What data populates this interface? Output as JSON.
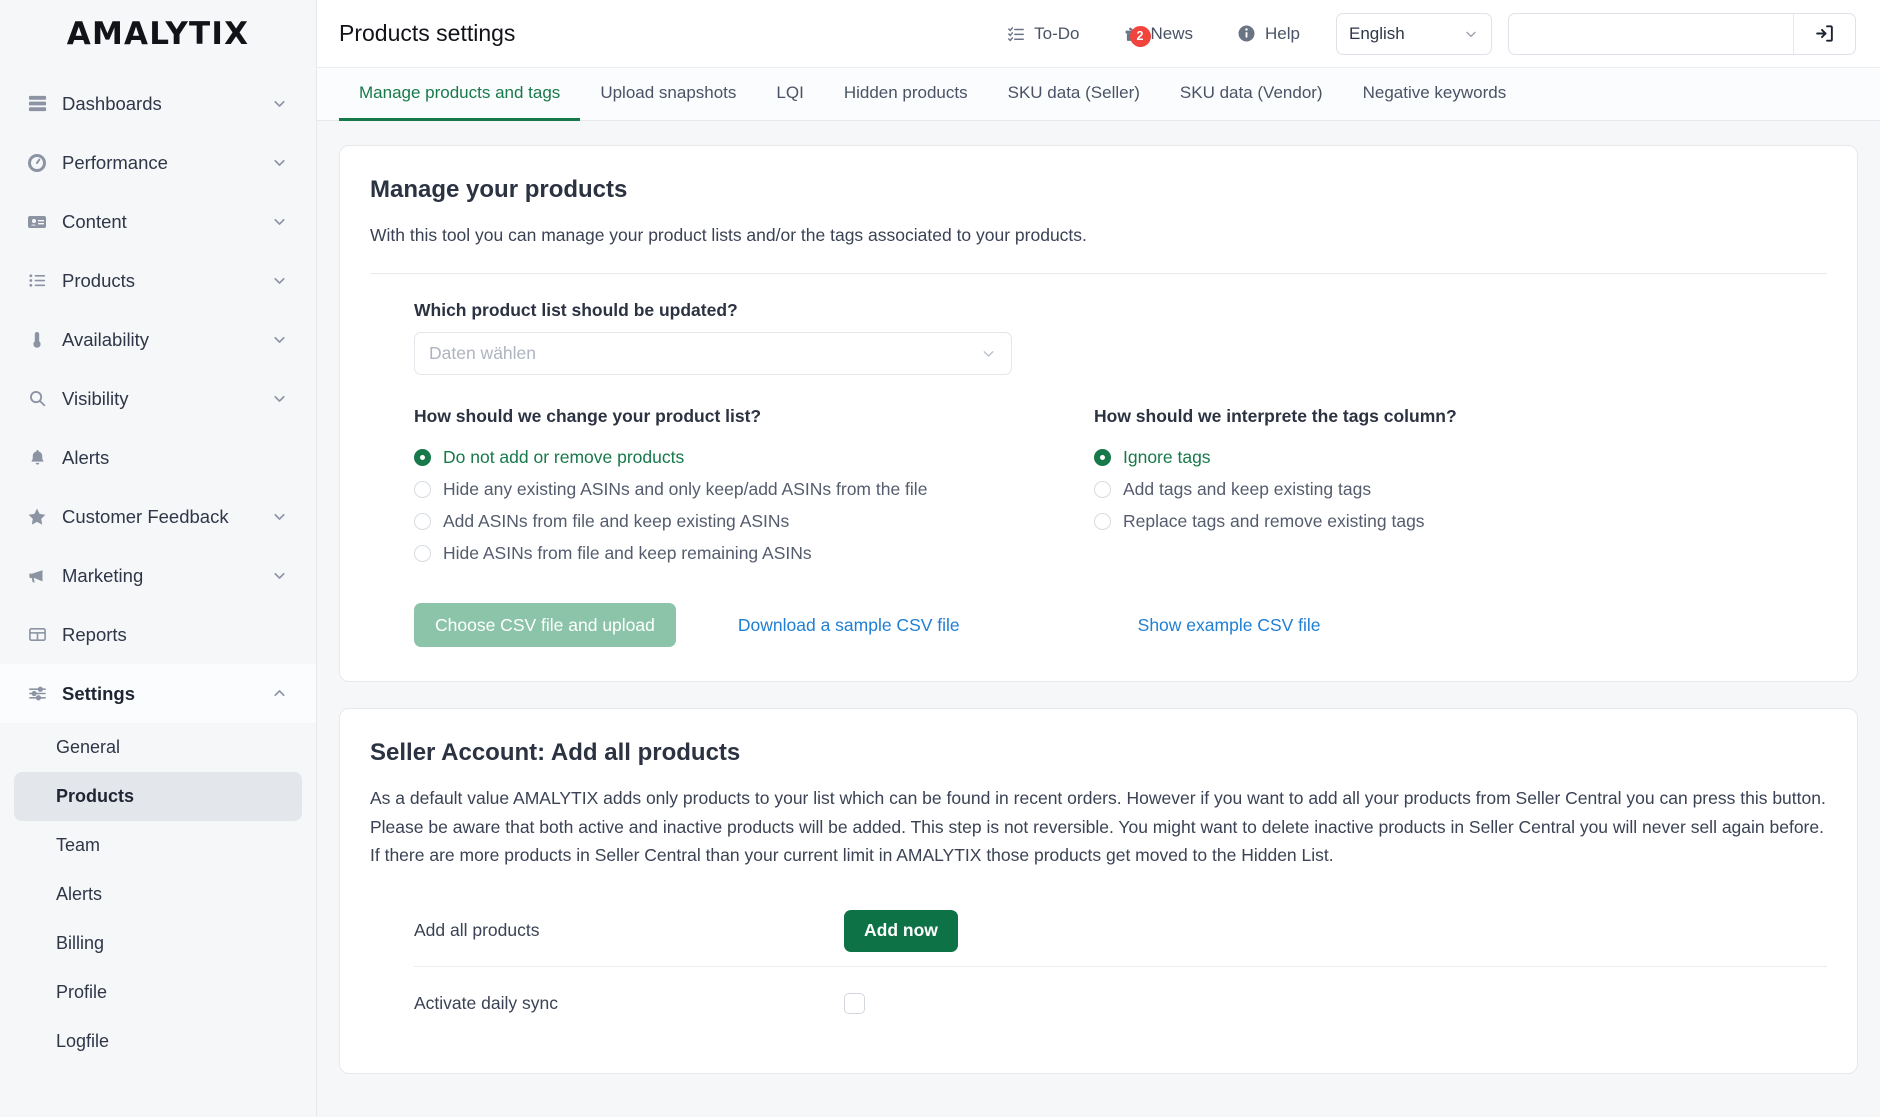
{
  "brand": {
    "name": "AMALYTIX"
  },
  "sidebar": {
    "items": [
      {
        "label": "Dashboards",
        "icon": "dashboards-icon",
        "chevron": "down"
      },
      {
        "label": "Performance",
        "icon": "gauge-icon",
        "chevron": "down"
      },
      {
        "label": "Content",
        "icon": "id-card-icon",
        "chevron": "down"
      },
      {
        "label": "Products",
        "icon": "list-icon",
        "chevron": "down"
      },
      {
        "label": "Availability",
        "icon": "thermometer-icon",
        "chevron": "down"
      },
      {
        "label": "Visibility",
        "icon": "search-icon",
        "chevron": "down"
      },
      {
        "label": "Alerts",
        "icon": "bell-icon",
        "chevron": "none"
      },
      {
        "label": "Customer Feedback",
        "icon": "star-icon",
        "chevron": "down"
      },
      {
        "label": "Marketing",
        "icon": "megaphone-icon",
        "chevron": "down"
      },
      {
        "label": "Reports",
        "icon": "table-icon",
        "chevron": "none"
      },
      {
        "label": "Settings",
        "icon": "sliders-icon",
        "chevron": "up"
      }
    ],
    "settings_submenu": [
      {
        "label": "General",
        "selected": false
      },
      {
        "label": "Products",
        "selected": true
      },
      {
        "label": "Team",
        "selected": false
      },
      {
        "label": "Alerts",
        "selected": false
      },
      {
        "label": "Billing",
        "selected": false
      },
      {
        "label": "Profile",
        "selected": false
      },
      {
        "label": "Logfile",
        "selected": false
      }
    ]
  },
  "topbar": {
    "page_title": "Products settings",
    "todo_label": "To-Do",
    "news_label": "News",
    "news_badge": "2",
    "help_label": "Help",
    "language": "English",
    "search_value": "",
    "search_placeholder": ""
  },
  "tabs": [
    {
      "label": "Manage products and tags",
      "active": true
    },
    {
      "label": "Upload snapshots",
      "active": false
    },
    {
      "label": "LQI",
      "active": false
    },
    {
      "label": "Hidden products",
      "active": false
    },
    {
      "label": "SKU data (Seller)",
      "active": false
    },
    {
      "label": "SKU data (Vendor)",
      "active": false
    },
    {
      "label": "Negative keywords",
      "active": false
    }
  ],
  "manage_card": {
    "title": "Manage your products",
    "description": "With this tool you can manage your product lists and/or the tags associated to your products.",
    "list_field_label": "Which product list should be updated?",
    "list_select_placeholder": "Daten wählen",
    "list_select_value": "",
    "change_group_label": "How should we change your product list?",
    "change_options": [
      {
        "label": "Do not add or remove products",
        "selected": true
      },
      {
        "label": "Hide any existing ASINs and only keep/add ASINs from the file",
        "selected": false
      },
      {
        "label": "Add ASINs from file and keep existing ASINs",
        "selected": false
      },
      {
        "label": "Hide ASINs from file and keep remaining ASINs",
        "selected": false
      }
    ],
    "tags_group_label": "How should we interprete the tags column?",
    "tags_options": [
      {
        "label": "Ignore tags",
        "selected": true
      },
      {
        "label": "Add tags and keep existing tags",
        "selected": false
      },
      {
        "label": "Replace tags and remove existing tags",
        "selected": false
      }
    ],
    "upload_button": "Choose CSV file and upload",
    "sample_link": "Download a sample CSV file",
    "example_link": "Show example CSV file"
  },
  "seller_card": {
    "title": "Seller Account: Add all products",
    "description": "As a default value AMALYTIX adds only products to your list which can be found in recent orders. However if you want to add all your products from Seller Central you can press this button. Please be aware that both active and inactive products will be added. This step is not reversible. You might want to delete inactive products in Seller Central you will never sell again before. If there are more products in Seller Central than your current limit in AMALYTIX those products get moved to the Hidden List.",
    "add_all_label": "Add all products",
    "add_now_button": "Add now",
    "daily_sync_label": "Activate daily sync",
    "daily_sync_checked": false
  },
  "colors": {
    "accent_green": "#17794a",
    "button_green": "#0d7347",
    "muted_green": "#8cc4a9",
    "link_blue": "#1f7fd4",
    "badge_red": "#f0443c"
  }
}
